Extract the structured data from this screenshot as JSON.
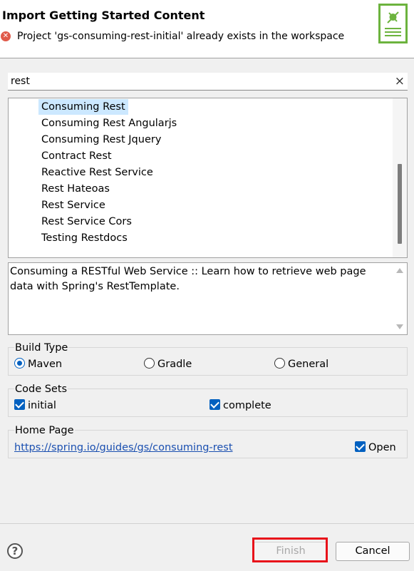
{
  "dialog": {
    "title": "Import Getting Started Content",
    "error_message": "Project 'gs-consuming-rest-initial' already exists in the workspace",
    "error_icon": "error-icon",
    "banner_icon": "spring-leaf-icon",
    "accent_color": "#6cb33e"
  },
  "search": {
    "value": "rest",
    "clear_icon": "×"
  },
  "guides": {
    "items": [
      "Consuming Rest",
      "Consuming Rest Angularjs",
      "Consuming Rest Jquery",
      "Contract Rest",
      "Reactive Rest Service",
      "Rest Hateoas",
      "Rest Service",
      "Rest Service Cors",
      "Testing Restdocs"
    ],
    "selected_index": 0
  },
  "description": {
    "text": "Consuming a RESTful Web Service :: Learn how to retrieve web page data with Spring's RestTemplate."
  },
  "build_type": {
    "label": "Build Type",
    "options": [
      "Maven",
      "Gradle",
      "General"
    ],
    "selected": "Maven"
  },
  "code_sets": {
    "label": "Code Sets",
    "options": [
      {
        "label": "initial",
        "checked": true
      },
      {
        "label": "complete",
        "checked": true
      }
    ]
  },
  "home_page": {
    "label": "Home Page",
    "url": "https://spring.io/guides/gs/consuming-rest",
    "open_label": "Open",
    "open_checked": true
  },
  "buttons": {
    "help": "?",
    "finish": "Finish",
    "cancel": "Cancel",
    "finish_enabled": false
  }
}
